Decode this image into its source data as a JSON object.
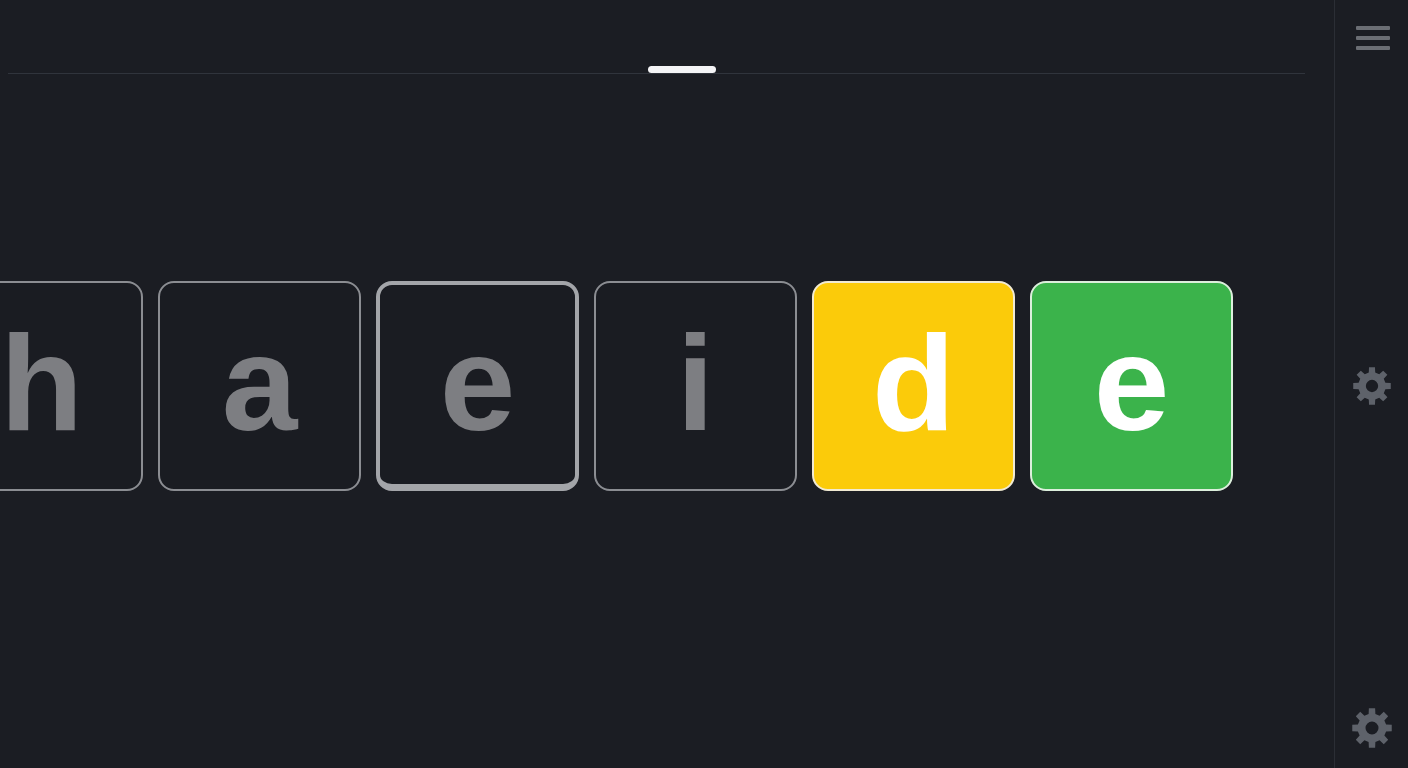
{
  "tiles": [
    {
      "letter": "h",
      "kind": "blank",
      "selected": false
    },
    {
      "letter": "a",
      "kind": "blank",
      "selected": false
    },
    {
      "letter": "e",
      "kind": "blank",
      "selected": true
    },
    {
      "letter": "i",
      "kind": "blank",
      "selected": false
    },
    {
      "letter": "d",
      "kind": "present",
      "selected": false
    },
    {
      "letter": "e",
      "kind": "correct",
      "selected": false
    }
  ]
}
